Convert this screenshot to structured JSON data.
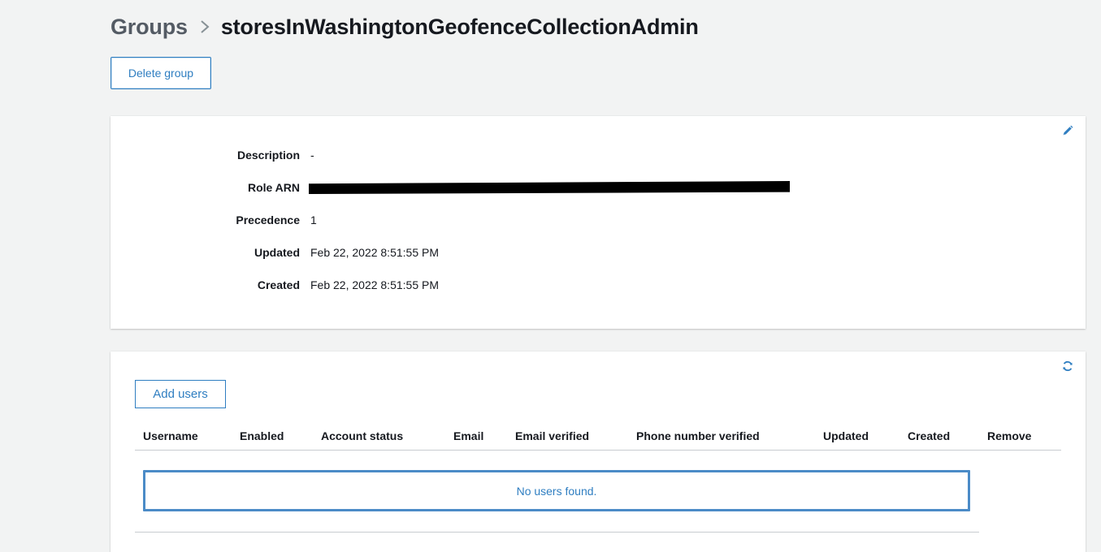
{
  "breadcrumb": {
    "parent": "Groups",
    "current": "storesInWashingtonGeofenceCollectionAdmin"
  },
  "actions": {
    "delete_group": "Delete group",
    "add_users": "Add users"
  },
  "details": {
    "description_label": "Description",
    "description_value": "-",
    "role_arn_label": "Role ARN",
    "precedence_label": "Precedence",
    "precedence_value": "1",
    "updated_label": "Updated",
    "updated_value": "Feb 22, 2022 8:51:55 PM",
    "created_label": "Created",
    "created_value": "Feb 22, 2022 8:51:55 PM"
  },
  "users_table": {
    "columns": [
      "Username",
      "Enabled",
      "Account status",
      "Email",
      "Email verified",
      "Phone number verified",
      "Updated",
      "Created",
      "Remove"
    ],
    "empty_message": "No users found."
  },
  "icons": {
    "edit": "pencil-icon",
    "refresh": "refresh-icon",
    "separator": "chevron-right-icon"
  },
  "colors": {
    "accent": "#2f7ec1",
    "background": "#f2f3f3",
    "empty_border": "#4b8bc7"
  }
}
